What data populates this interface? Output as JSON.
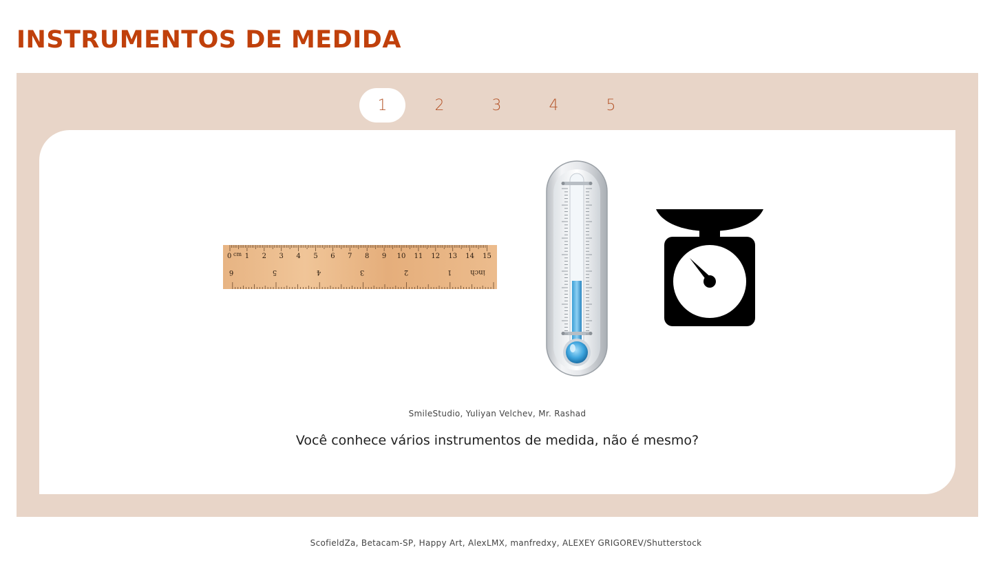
{
  "header": {
    "title": "INSTRUMENTOS DE MEDIDA"
  },
  "carousel": {
    "tabs": [
      {
        "label": "1",
        "active": true
      },
      {
        "label": "2",
        "active": false
      },
      {
        "label": "3",
        "active": false
      },
      {
        "label": "4",
        "active": false
      },
      {
        "label": "5",
        "active": false
      }
    ],
    "slide": {
      "images": [
        {
          "icon": "ruler-icon",
          "top_labels": [
            "0",
            "cm",
            "1",
            "2",
            "3",
            "4",
            "5",
            "6",
            "7",
            "8",
            "9",
            "10",
            "11",
            "12",
            "13",
            "14",
            "15"
          ],
          "bottom_labels": [
            "6",
            "5",
            "4",
            "3",
            "2",
            "1",
            "inch"
          ]
        },
        {
          "icon": "thermometer-icon"
        },
        {
          "icon": "kitchen-scale-icon"
        }
      ],
      "image_credit": "SmileStudio, Yuliyan Velchev, Mr. Rashad",
      "caption": "Você conhece vários instrumentos de medida, não é mesmo?"
    }
  },
  "footer": {
    "credit": "ScofieldZa, Betacam-SP, Happy Art, AlexLMX, manfredxy, ALEXEY GRIGOREV/Shutterstock"
  },
  "colors": {
    "title": "#c0400b",
    "carousel_bg": "#e8d5c8",
    "tab_text": "#b5552a",
    "card_bg": "#ffffff"
  }
}
